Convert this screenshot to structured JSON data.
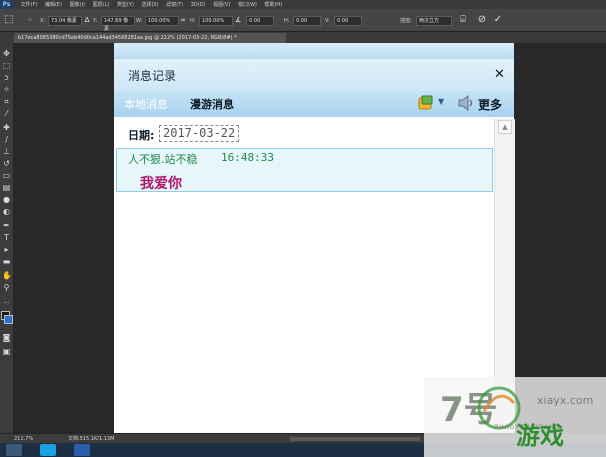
{
  "photoshop": {
    "app_badge": "Ps",
    "menu": [
      "文件(F)",
      "编辑(E)",
      "图像(I)",
      "图层(L)",
      "类型(Y)",
      "选择(S)",
      "滤镜(T)",
      "3D(D)",
      "视图(V)",
      "窗口(W)",
      "帮助(H)"
    ],
    "options": {
      "x_label": "X:",
      "x_value": "73.04 像素",
      "y_label": "Y:",
      "y_value": "147.69 像素",
      "w_label": "W:",
      "w_value": "100.00%",
      "h_label": "H:",
      "h_value": "100.00%",
      "angle_value": "0.00",
      "hskew_label": "H:",
      "hskew_value": "0.00",
      "vskew_label": "V:",
      "vskew_value": "0.00",
      "interp_label": "插值:",
      "interp_value": "两次立方"
    },
    "doc_tab": "b17eca8065380cd75eb40d0ca144ad34588281aa.jpg @ 212% (2017-03-22, RGB/8#) *",
    "status": {
      "zoom": "211.7%",
      "doc": "文档:515.1K/1.13M"
    }
  },
  "chat": {
    "title": "消息记录",
    "close_symbol": "✕",
    "tabs": [
      "本地消息",
      "漫游消息"
    ],
    "more_label": "更多",
    "date_label": "日期:",
    "date_value": "2017-03-22",
    "message": {
      "sender": "人不狠.站不稳",
      "time": "16:48:33",
      "text": "我爱你"
    }
  },
  "watermark": {
    "big_text": "7号",
    "domain": "xiayx.com",
    "pinyin": "ZHAOYOUXIDANG",
    "brand": "游戏"
  },
  "colors": {
    "chat_header": "#cfe7f7",
    "message_sender": "#1e8a4a",
    "message_text": "#b0166e",
    "message_bg": "#e6f6fb"
  }
}
